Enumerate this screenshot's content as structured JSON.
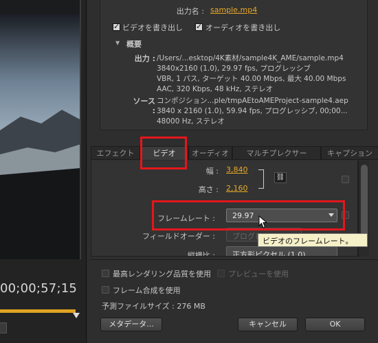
{
  "preview": {
    "timecode": "00;00;57;15"
  },
  "output": {
    "name_label": "出力名 :",
    "name_value": "sample.mp4",
    "export_video_label": "ビデオを書き出し",
    "export_audio_label": "オーディオを書き出し",
    "export_video_checked": true,
    "export_audio_checked": true
  },
  "summary": {
    "title": "概要",
    "output_key": "出力 :",
    "output_lines": [
      "/Users/...esktop/4K素材/sample4K_AME/sample.mp4",
      "3840x2160 (1.0), 29.97 fps, プログレッシブ",
      "VBR, 1 パス, ターゲット 40.00 Mbps, 最大 40.00 Mbps",
      "AAC, 320 Kbps, 48 kHz, ステレオ"
    ],
    "source_key": "ソース :",
    "source_lines": [
      "コンポジション...ple/tmpAEtoAMEProject-sample4.aep",
      "3840 x 2160 (1.0), 59.94 fps, プログレッシブ, 00;00...",
      "48000 Hz, ステレオ"
    ]
  },
  "tabs": [
    {
      "label": "エフェクト",
      "active": false
    },
    {
      "label": "ビデオ",
      "active": true
    },
    {
      "label": "オーディオ",
      "active": false
    },
    {
      "label": "マルチプレクサー",
      "active": false
    },
    {
      "label": "キャプション",
      "active": false
    }
  ],
  "video": {
    "width_label": "幅 :",
    "width_value": "3,840",
    "height_label": "高さ :",
    "height_value": "2,160",
    "link_icon": "link-icon",
    "framerate_label": "フレームレート :",
    "framerate_value": "29.97",
    "field_order_label": "フィールドオーダー :",
    "field_order_value": "プログレ",
    "aspect_label": "縦横比 :",
    "aspect_value": "正方形ピクセル (1.0)"
  },
  "tooltip": "ビデオのフレームレート。",
  "bottom": {
    "max_quality_label": "最高レンダリング品質を使用",
    "preview_label": "プレビューを使用",
    "frame_blend_label": "フレーム合成を使用",
    "file_size": "予測ファイルサイズ : 276 MB",
    "metadata_button": "メタデータ...",
    "cancel_button": "キャンセル",
    "ok_button": "OK"
  },
  "colors": {
    "accent": "#e8a927",
    "annotation": "#e5161c",
    "tooltip_bg": "#f5f0c8"
  }
}
